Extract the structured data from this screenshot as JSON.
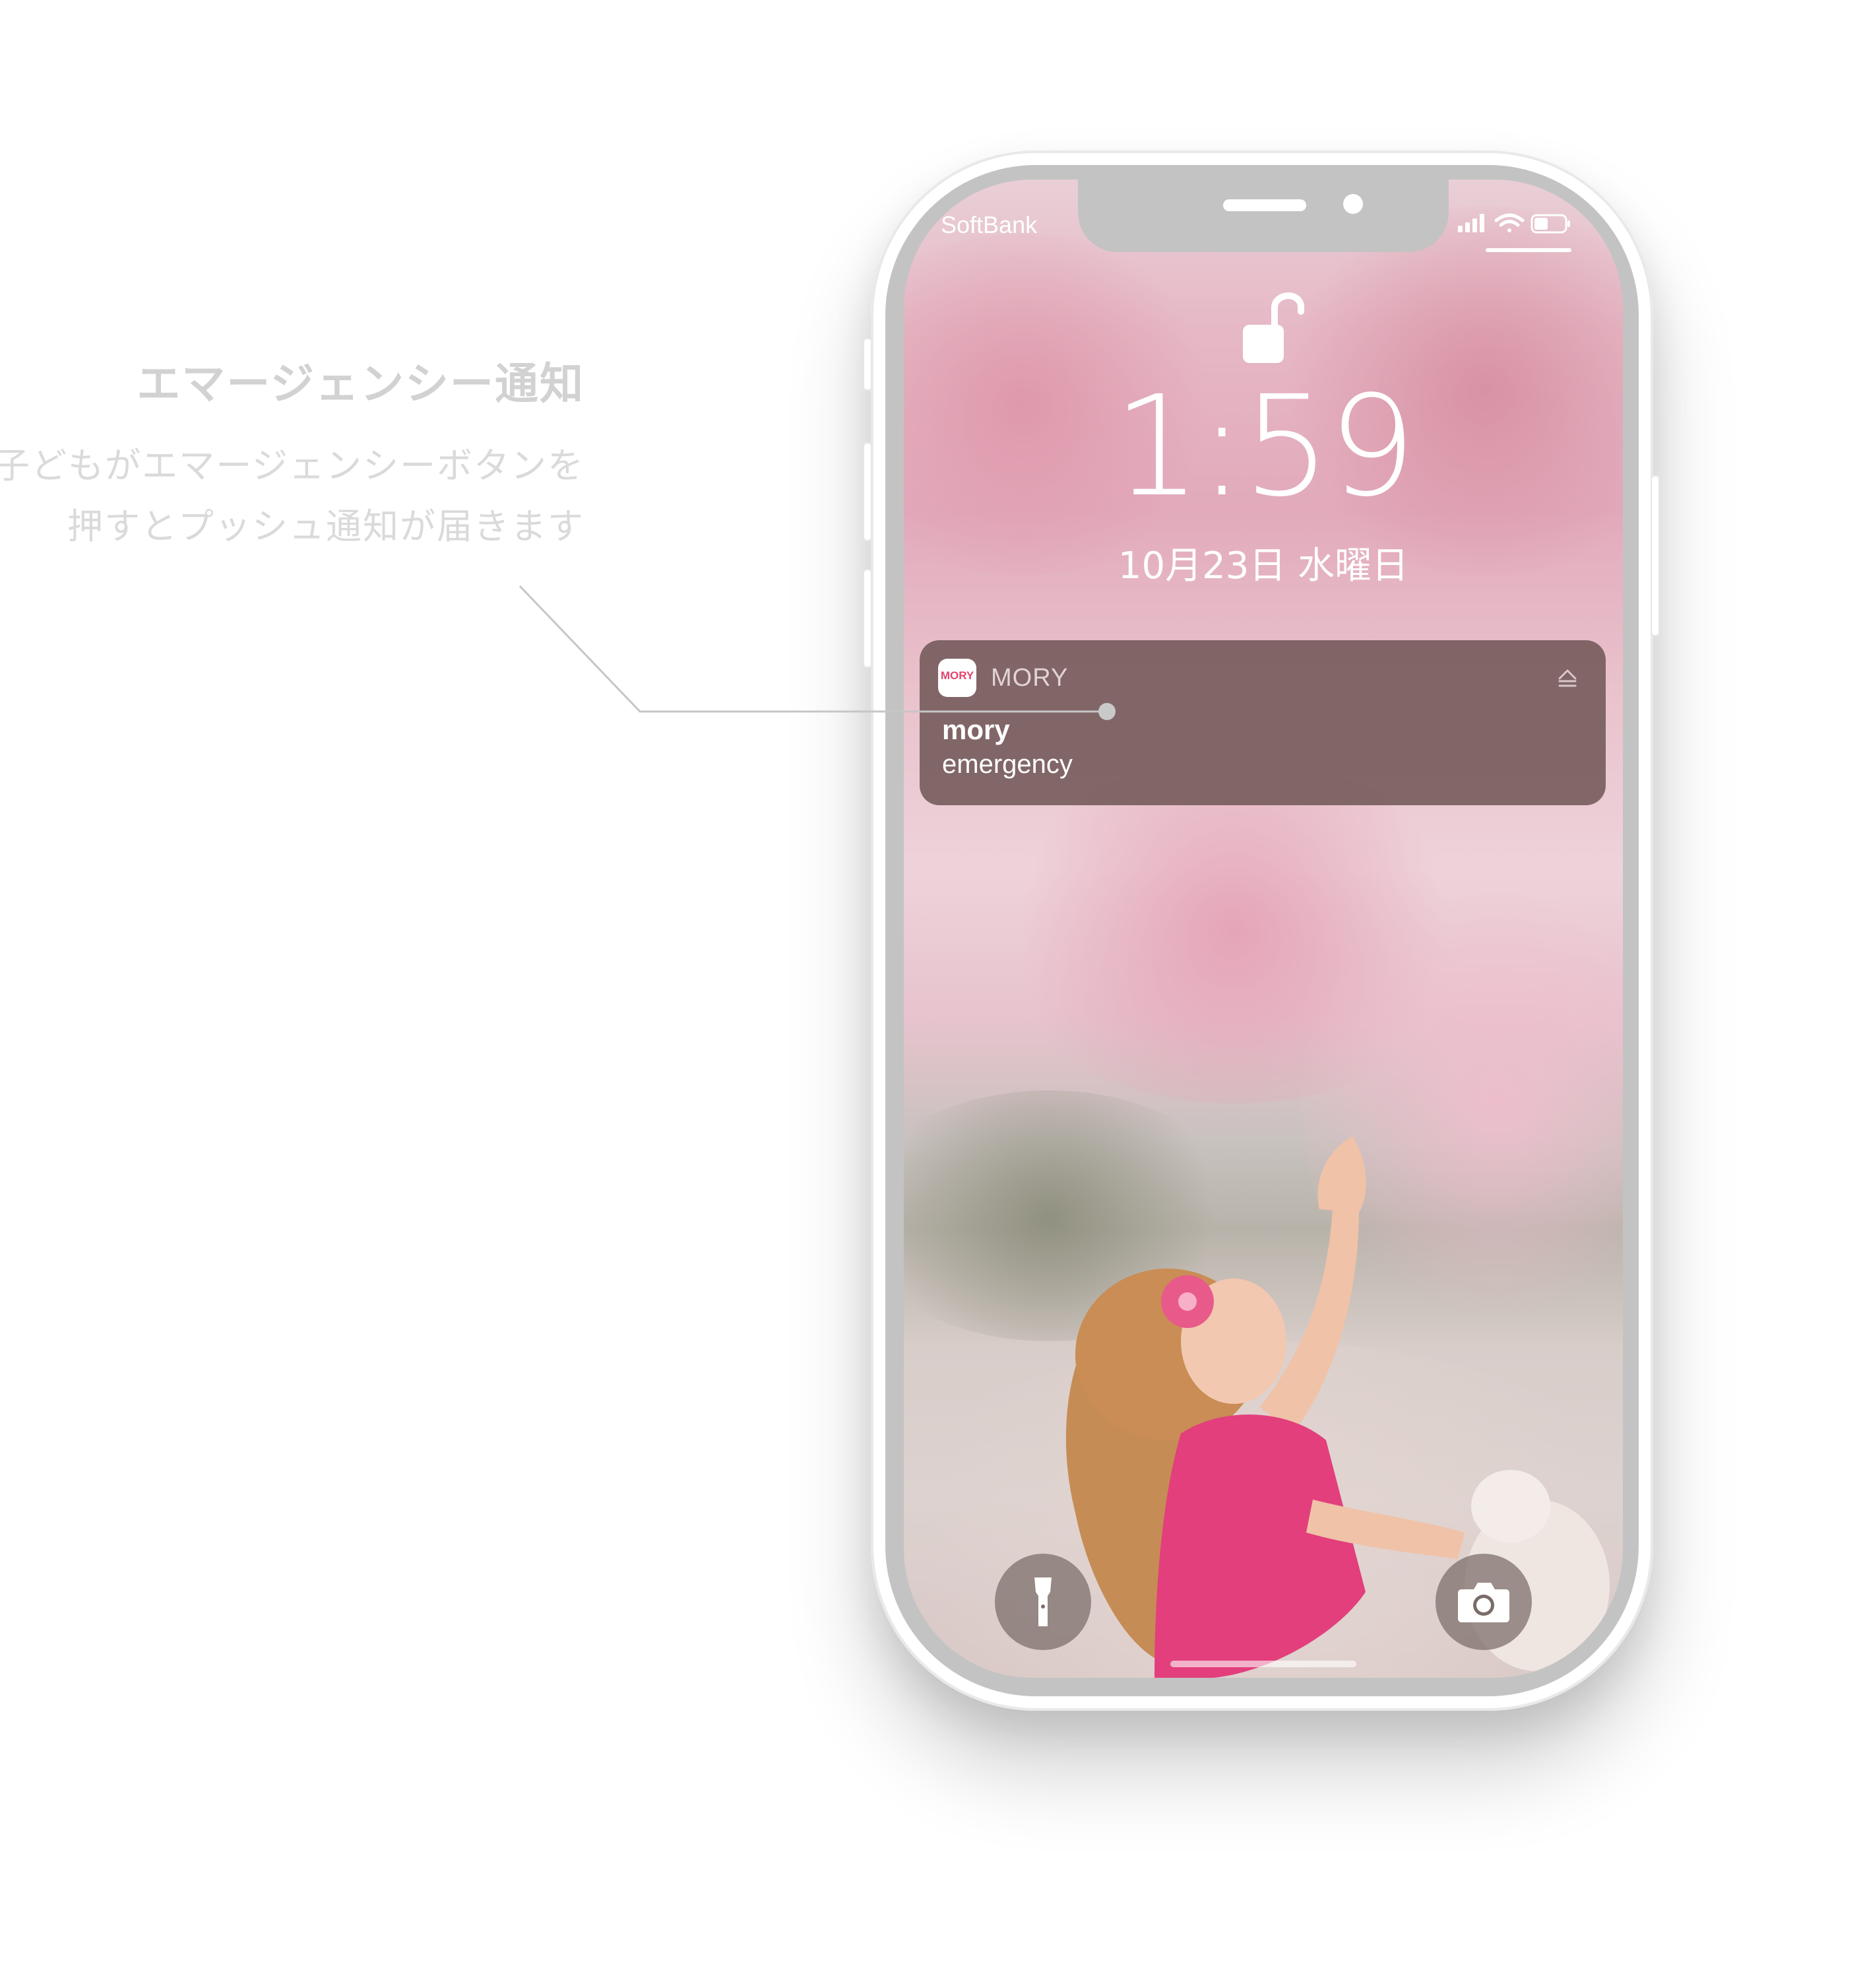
{
  "caption": {
    "title": "エマージェンシー通知",
    "line1": "子どもがエマージェンシーボタンを",
    "line2": "押すとプッシュ通知が届きます"
  },
  "status_bar": {
    "carrier": "SoftBank",
    "icons": [
      "signal-icon",
      "wifi-icon",
      "battery-icon"
    ]
  },
  "lock_screen": {
    "lock_icon": "unlock-icon",
    "time": "1:59",
    "date": "10月23日 水曜日"
  },
  "notification": {
    "app_icon_text": "MORY",
    "app_name": "MORY",
    "title": "mory",
    "body": "emergency",
    "expand_icon": "chevron-icon"
  },
  "quick_actions": {
    "left": "flashlight-icon",
    "right": "camera-icon"
  },
  "colors": {
    "notification_bg": "#6c5454",
    "brand_pink": "#e2446f",
    "caption_gray": "#d2d2d2"
  }
}
